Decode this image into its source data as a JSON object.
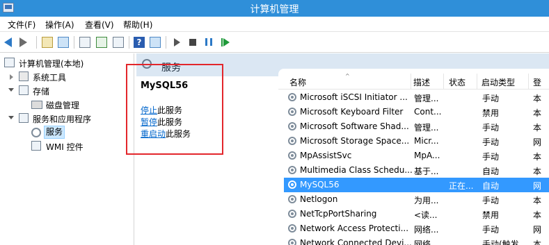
{
  "window": {
    "title": "计算机管理"
  },
  "menu": [
    "文件(F)",
    "操作(A)",
    "查看(V)",
    "帮助(H)"
  ],
  "tree": {
    "root": "计算机管理(本地)",
    "system_tools": "系统工具",
    "storage": "存储",
    "disk_management": "磁盘管理",
    "services_apps": "服务和应用程序",
    "services": "服务",
    "wmi": "WMI 控件"
  },
  "section": {
    "title": "服务"
  },
  "description": {
    "service_name": "MySQL56",
    "stop_link": "停止",
    "stop_suffix": "此服务",
    "pause_link": "暂停",
    "pause_suffix": "此服务",
    "restart_link": "重启动",
    "restart_suffix": "此服务"
  },
  "list": {
    "columns": [
      "名称",
      "描述",
      "状态",
      "启动类型",
      "登"
    ],
    "rows": [
      {
        "name": "Microsoft iSCSI Initiator ...",
        "desc": "管理...",
        "status": "",
        "startup": "手动",
        "logon": "本"
      },
      {
        "name": "Microsoft Keyboard Filter",
        "desc": "Cont...",
        "status": "",
        "startup": "禁用",
        "logon": "本"
      },
      {
        "name": "Microsoft Software Shad...",
        "desc": "管理...",
        "status": "",
        "startup": "手动",
        "logon": "本"
      },
      {
        "name": "Microsoft Storage Space...",
        "desc": "Micr...",
        "status": "",
        "startup": "手动",
        "logon": "网"
      },
      {
        "name": "MpAssistSvc",
        "desc": "MpA...",
        "status": "",
        "startup": "手动",
        "logon": "本"
      },
      {
        "name": "Multimedia Class Schedu...",
        "desc": "基于...",
        "status": "",
        "startup": "自动",
        "logon": "本"
      },
      {
        "name": "MySQL56",
        "desc": "",
        "status": "正在...",
        "startup": "自动",
        "logon": "网"
      },
      {
        "name": "Netlogon",
        "desc": "为用...",
        "status": "",
        "startup": "手动",
        "logon": "本"
      },
      {
        "name": "NetTcpPortSharing",
        "desc": "<读...",
        "status": "",
        "startup": "禁用",
        "logon": "本"
      },
      {
        "name": "Network Access Protecti...",
        "desc": "网络...",
        "status": "",
        "startup": "手动",
        "logon": "网"
      },
      {
        "name": "Network Connected Devi...",
        "desc": "网络...",
        "status": "",
        "startup": "手动(触发...",
        "logon": "本"
      }
    ]
  },
  "colors": {
    "accent": "#3399ff",
    "titlebar": "#2f8fd9",
    "highlight_box": "#e3262b",
    "link": "#0066cc"
  }
}
